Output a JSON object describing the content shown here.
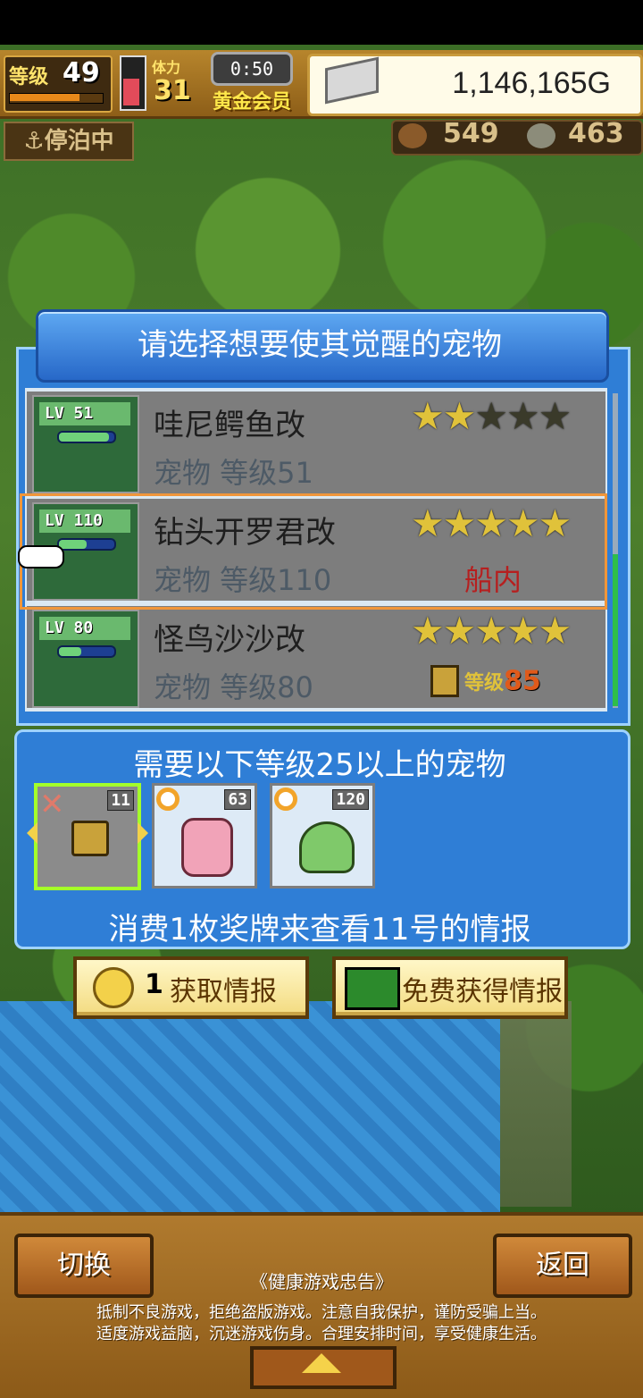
{
  "hud": {
    "level_label": "等级",
    "level_value": "49",
    "level_progress": 0.76,
    "stamina_label": "体力",
    "stamina_value": "31",
    "stamina_progress": 0.5,
    "timer": "0:50",
    "membership": "黄金会员",
    "gold": "1,146,165G",
    "status": "停泊中",
    "resource_1": "549",
    "resource_2": "463"
  },
  "dialog": {
    "title": "请选择想要使其觉醒的宠物",
    "pets": [
      {
        "lv_tag": "LV 51",
        "name": "哇尼鳄鱼改",
        "sub": "宠物 等级51",
        "stars": 2,
        "max_stars": 5,
        "hp": 0.9,
        "status": ""
      },
      {
        "lv_tag": "LV 110",
        "name": "钻头开罗君改",
        "sub": "宠物 等级110",
        "stars": 5,
        "max_stars": 5,
        "hp": 0.5,
        "status": "船内"
      },
      {
        "lv_tag": "LV 80",
        "name": "怪鸟沙沙改",
        "sub": "宠物 等级80",
        "stars": 5,
        "max_stars": 5,
        "hp": 0.4,
        "status": "",
        "lock_label": "等级",
        "lock_level": "85"
      }
    ]
  },
  "requirement": {
    "title": "需要以下等级25以上的宠物",
    "slots": [
      {
        "num": "11"
      },
      {
        "num": "63"
      },
      {
        "num": "120"
      }
    ],
    "info": "消费1枚奖牌来查看11号的情报"
  },
  "buttons": {
    "get_info_cost": "1",
    "get_info": "获取情报",
    "free_info": "免费获得情报",
    "switch": "切换",
    "back": "返回"
  },
  "notice": {
    "title": "《健康游戏忠告》",
    "line1": "抵制不良游戏，拒绝盗版游戏。注意自我保护，谨防受骗上当。",
    "line2": "适度游戏益脑，沉迷游戏伤身。合理安排时间，享受健康生活。"
  },
  "colors": {
    "accent_blue": "#2f7ed6",
    "selected_border": "#f0963a",
    "in_cabin": "#b61f1f",
    "star": "#e0c23a"
  }
}
